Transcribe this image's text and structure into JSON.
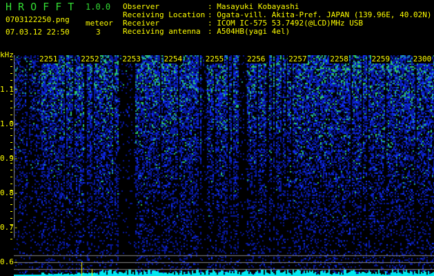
{
  "app": {
    "name": "H R O F F T",
    "version": "1.0.0"
  },
  "file": {
    "name": "0703122250.png",
    "datetime": "07.03.12 22:50"
  },
  "meteor": {
    "label": "meteor",
    "count": "3"
  },
  "info": [
    {
      "label": "Observer",
      "value": ": Masayuki Kobayashi"
    },
    {
      "label": "Receiving Location",
      "value": ": Ogata-vill. Akita-Pref. JAPAN (139.96E, 40.02N)"
    },
    {
      "label": "Receiver",
      "value": ": ICOM IC-575 53.7492(@LCD)MHz USB"
    },
    {
      "label": "Receiving antenna",
      "value": ": A504HB(yagi 4el)"
    }
  ],
  "axis": {
    "y_unit": "kHz",
    "y_ticks": [
      "1.1",
      "1.0",
      "0.9",
      "0.8",
      "0.7",
      "0.6"
    ],
    "x_ticks": [
      "2251",
      "2252",
      "2253",
      "2254",
      "2255",
      "2256",
      "2257",
      "2258",
      "2259",
      "2300"
    ]
  },
  "colors": {
    "text": "#ffff00",
    "title": "#33dd33",
    "level": "#00ffff",
    "noise": "#0000ff",
    "signal": "#00ff66"
  }
}
